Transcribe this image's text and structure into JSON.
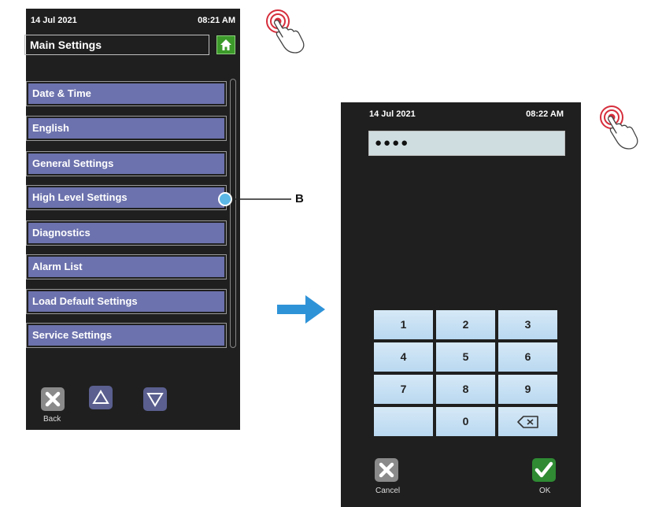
{
  "screen_main": {
    "date": "14 Jul 2021",
    "time": "08:21 AM",
    "title": "Main Settings",
    "menu": [
      {
        "label": "Date & Time"
      },
      {
        "label": "English"
      },
      {
        "label": "General Settings"
      },
      {
        "label": "High Level Settings"
      },
      {
        "label": "Diagnostics"
      },
      {
        "label": "Alarm List"
      },
      {
        "label": "Load Default Settings"
      },
      {
        "label": "Service Settings"
      }
    ],
    "back_label": "Back"
  },
  "screen_pin": {
    "date": "14 Jul 2021",
    "time": "08:22 AM",
    "password_value": "●●●●",
    "keys": [
      "1",
      "2",
      "3",
      "4",
      "5",
      "6",
      "7",
      "8",
      "9",
      "",
      "0"
    ],
    "cancel_label": "Cancel",
    "ok_label": "OK"
  },
  "annotation": {
    "callout_label": "B"
  },
  "colors": {
    "screen_bg": "#1f1f1f",
    "menu_fill": "#6c72ad",
    "home_green": "#3c9a2a",
    "ok_green": "#2f8a33",
    "arrow_blue": "#2f93d8",
    "callout_blue": "#5bb7e6",
    "touch_red": "#d62e3c",
    "key_blue": "#c7e1f4"
  },
  "icons": [
    "home-icon",
    "close-x-icon",
    "triangle-up-icon",
    "triangle-down-icon",
    "backspace-icon",
    "checkmark-icon",
    "touch-hand-icon",
    "right-arrow-icon"
  ]
}
